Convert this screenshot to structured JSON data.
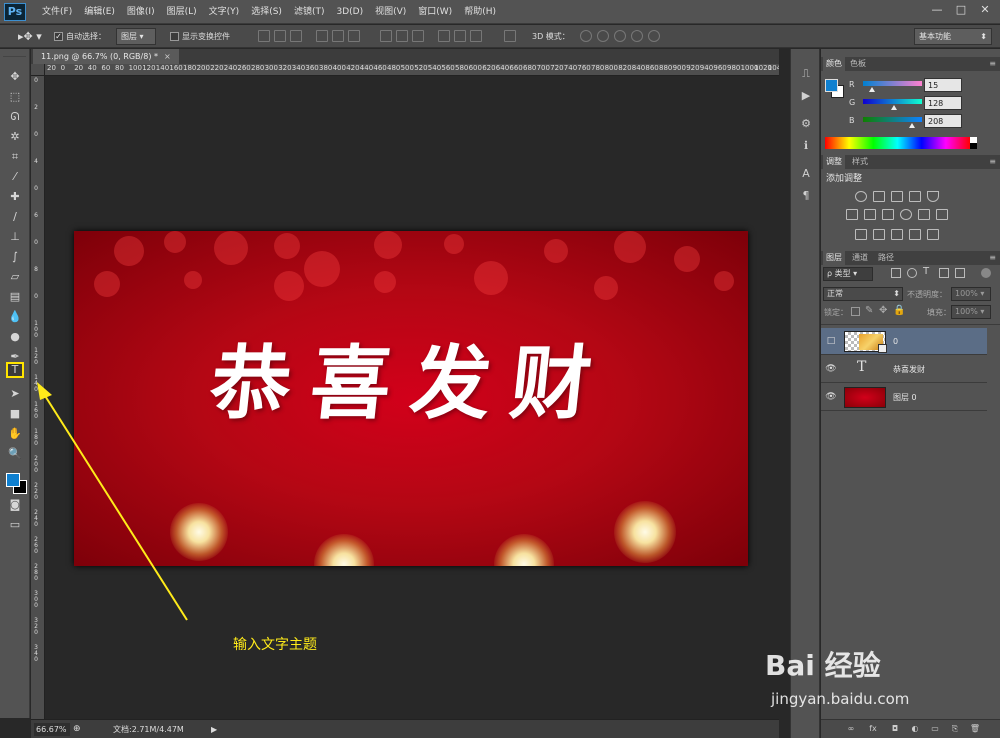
{
  "app": {
    "logo": "Ps"
  },
  "menubar": {
    "items": [
      "文件(F)",
      "编辑(E)",
      "图像(I)",
      "图层(L)",
      "文字(Y)",
      "选择(S)",
      "滤镜(T)",
      "3D(D)",
      "视图(V)",
      "窗口(W)",
      "帮助(H)"
    ],
    "window_controls": [
      "—",
      "□",
      "✕"
    ]
  },
  "options": {
    "auto_select_label": "自动选择：",
    "auto_select_checked": true,
    "auto_select_value": "图层",
    "show_transform_label": "显示变换控件",
    "mode_3d_label": "3D 模式：",
    "workspace": "基本功能"
  },
  "document": {
    "tab_title": "11.png @ 66.7% (0, RGB/8) *",
    "close": "×",
    "greeting": "恭喜发财",
    "colors": {
      "red": "#c0000f",
      "gold": "#f7e2a0"
    }
  },
  "ruler": {
    "h_labels": [
      "20",
      "0",
      "20",
      "40",
      "60",
      "80",
      "100",
      "120",
      "140",
      "160",
      "180",
      "200",
      "220",
      "240",
      "260",
      "280",
      "300",
      "320",
      "340",
      "360",
      "380",
      "400",
      "420",
      "440",
      "460",
      "480",
      "500",
      "520",
      "540",
      "560",
      "580",
      "600",
      "620",
      "640",
      "660",
      "680",
      "700",
      "720",
      "740",
      "760",
      "780",
      "800",
      "820",
      "840",
      "860",
      "880",
      "900",
      "920",
      "940",
      "960",
      "980",
      "1000",
      "1020",
      "1040",
      "1060"
    ],
    "v_labels": [
      "0",
      "2",
      "0",
      "4",
      "0",
      "6",
      "0",
      "8",
      "0",
      "1 0 0",
      "1 2 0",
      "1 4 0",
      "1 6 0",
      "1 8 0",
      "2 0 0",
      "2 2 0",
      "2 4 0",
      "2 6 0",
      "2 8 0",
      "3 0 0",
      "3 2 0",
      "3 4 0"
    ]
  },
  "annotation": {
    "text": "输入文字主题",
    "color": "#ffeb1a"
  },
  "status": {
    "zoom": "66.67%",
    "doc_info": "文档:2.71M/4.47M",
    "arrow": "▶"
  },
  "panels": {
    "color": {
      "tabs": [
        "颜色",
        "色板"
      ],
      "r": {
        "label": "R",
        "value": "15"
      },
      "g": {
        "label": "G",
        "value": "128"
      },
      "b": {
        "label": "B",
        "value": "208"
      },
      "fg_hex": "#0f80d0"
    },
    "adjustments": {
      "tabs": [
        "调整",
        "样式"
      ],
      "title": "添加调整"
    },
    "layers": {
      "tabs": [
        "图层",
        "通道",
        "路径"
      ],
      "filter": "ρ 类型",
      "blend_mode": "正常",
      "opacity_label": "不透明度：",
      "opacity": "100%",
      "lock_label": "锁定：",
      "fill_label": "填充：",
      "fill": "100%",
      "list": [
        {
          "name": "0",
          "type": "smart",
          "visible": false,
          "selected": true
        },
        {
          "name": "恭喜发财",
          "type": "text",
          "visible": true,
          "selected": false
        },
        {
          "name": "图层 0",
          "type": "image",
          "visible": true,
          "selected": false
        }
      ],
      "bottom_icons": [
        "∞",
        "fx"
      ]
    }
  },
  "watermark": {
    "logo": "Bai 经验",
    "url": "jingyan.baidu.com"
  }
}
